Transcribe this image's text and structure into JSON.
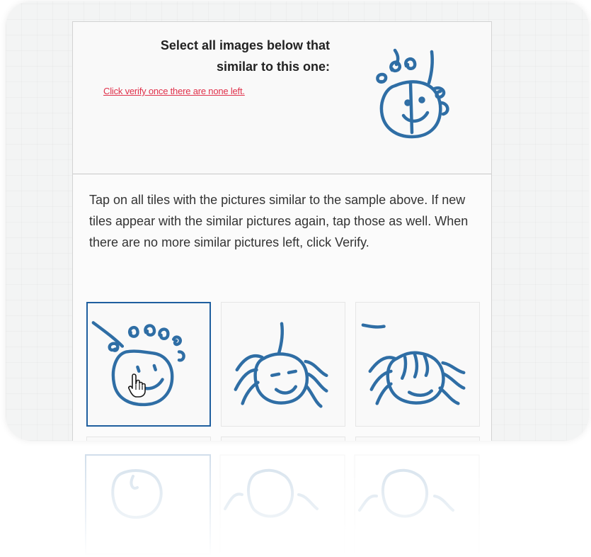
{
  "captcha": {
    "title_line1": "Select all images below that",
    "title_line2": "similar to this one:",
    "verify_hint": "Click verify once there are none left.",
    "instructions": "Tap on all tiles with the pictures similar to the sample above. If new tiles appear with the similar pictures again, tap those as well. When there are no more similar pictures left, click Verify."
  },
  "tiles": [
    {
      "selected": true
    },
    {
      "selected": false
    },
    {
      "selected": false
    }
  ],
  "colors": {
    "ink": "#2f6ea5",
    "selected_border": "#1f5f9f",
    "link": "#e0314b"
  },
  "icons": [
    "hand-pointer-icon"
  ]
}
